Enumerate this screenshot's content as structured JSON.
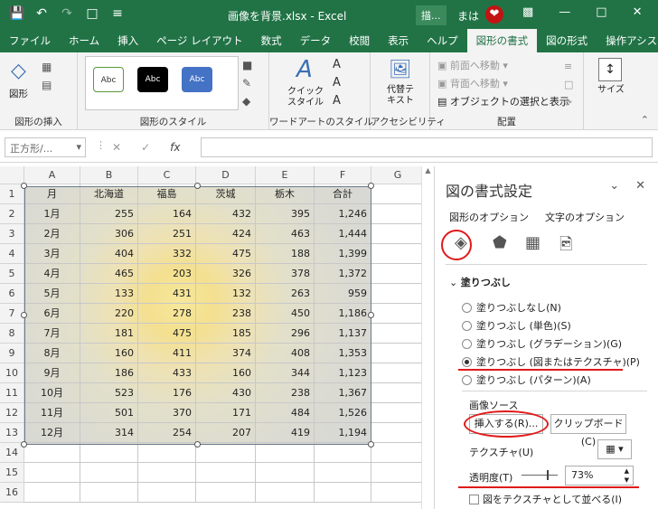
{
  "window": {
    "title": "画像を背景.xlsx - Excel",
    "draw_badge": "描...",
    "user_name": "まは"
  },
  "tabs": [
    "ファイル",
    "ホーム",
    "挿入",
    "ページ レイアウト",
    "数式",
    "データ",
    "校閲",
    "表示",
    "ヘルプ",
    "図形の書式",
    "図の形式",
    "操作アシス"
  ],
  "active_tab": "図形の書式",
  "ribbon": {
    "insert_shapes_group": "図形の挿入",
    "shape_label": "図形",
    "shape_styles_group": "図形のスタイル",
    "style_sample": "Abc",
    "quick_style": "クイック\nスタイル",
    "wordart_group": "ワードアートのスタイル",
    "alt_text": "代替テ\nキスト",
    "accessibility_group": "アクセシビリティ",
    "bring_forward": "前面へ移動",
    "send_backward": "背面へ移動",
    "selection_pane": "オブジェクトの選択と表示",
    "arrange_group": "配置",
    "size": "サイズ"
  },
  "formula_bar": {
    "name_box": "正方形/...",
    "fx": "fx"
  },
  "sheet": {
    "columns": [
      "A",
      "B",
      "C",
      "D",
      "E",
      "F",
      "G"
    ],
    "rows": [
      [
        "月",
        "北海道",
        "福島",
        "茨城",
        "栃木",
        "合計"
      ],
      [
        "1月",
        "255",
        "164",
        "432",
        "395",
        "1,246"
      ],
      [
        "2月",
        "306",
        "251",
        "424",
        "463",
        "1,444"
      ],
      [
        "3月",
        "404",
        "332",
        "475",
        "188",
        "1,399"
      ],
      [
        "4月",
        "465",
        "203",
        "326",
        "378",
        "1,372"
      ],
      [
        "5月",
        "133",
        "431",
        "132",
        "263",
        "959"
      ],
      [
        "6月",
        "220",
        "278",
        "238",
        "450",
        "1,186"
      ],
      [
        "7月",
        "181",
        "475",
        "185",
        "296",
        "1,137"
      ],
      [
        "8月",
        "160",
        "411",
        "374",
        "408",
        "1,353"
      ],
      [
        "9月",
        "186",
        "433",
        "160",
        "344",
        "1,123"
      ],
      [
        "10月",
        "523",
        "176",
        "430",
        "238",
        "1,367"
      ],
      [
        "11月",
        "501",
        "370",
        "171",
        "484",
        "1,526"
      ],
      [
        "12月",
        "314",
        "254",
        "207",
        "419",
        "1,194"
      ]
    ],
    "row_numbers": [
      "1",
      "2",
      "3",
      "4",
      "5",
      "6",
      "7",
      "8",
      "9",
      "10",
      "11",
      "12",
      "13",
      "14",
      "15",
      "16"
    ]
  },
  "pane": {
    "title": "図の書式設定",
    "tab_shape_options": "図形のオプション",
    "tab_text_options": "文字のオプション",
    "section_fill": "塗りつぶし",
    "options": [
      "塗りつぶしなし(N)",
      "塗りつぶし (単色)(S)",
      "塗りつぶし (グラデーション)(G)",
      "塗りつぶし (図またはテクスチャ)(P)",
      "塗りつぶし (パターン)(A)"
    ],
    "selected_option": 3,
    "image_source": "画像ソース",
    "insert_button": "挿入する(R)...",
    "clipboard_button": "クリップボード(C)",
    "texture_label": "テクスチャ(U)",
    "transparency_label": "透明度(T)",
    "transparency_value": "73%",
    "tile_checkbox": "図をテクスチャとして並べる(I)"
  }
}
